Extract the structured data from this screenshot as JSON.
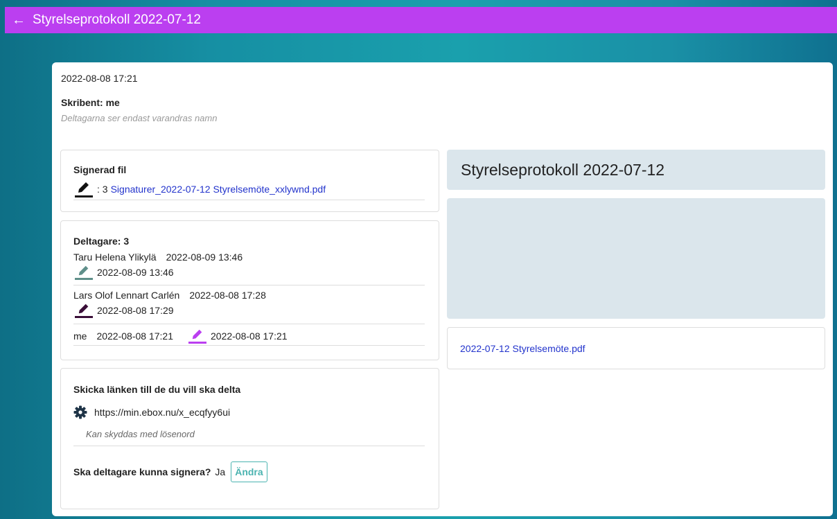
{
  "header": {
    "back_icon": "arrow-left-icon",
    "title": "Styrelseprotokoll 2022-07-12",
    "bg_color": "#bb3ff0"
  },
  "meta": {
    "date": "2022-08-08 17:21",
    "scribe": "Skribent: me",
    "scribe_note": "Deltagarna ser endast varandras namn"
  },
  "signed_file": {
    "title": "Signerad fil",
    "icon": "pen-icon",
    "count": ": 3",
    "file_link": "Signaturer_2022-07-12 Styrelsemöte_xxlywnd.pdf"
  },
  "participants": {
    "title": "Deltagare: 3",
    "rows": [
      {
        "name": "Taru Helena Ylikylä",
        "joined": "2022-08-09 13:46",
        "signed": "2022-08-09 13:46",
        "pen_color": "#5f8f8a"
      },
      {
        "name": "Lars Olof Lennart Carlén",
        "joined": "2022-08-08 17:28",
        "signed": "2022-08-08 17:29",
        "pen_color": "#3a0e38"
      },
      {
        "name": "me",
        "joined": "2022-08-08 17:21",
        "signed": "2022-08-08 17:21",
        "pen_color": "#bb3ff0"
      }
    ]
  },
  "share": {
    "title": "Skicka länken till de du vill ska delta",
    "icon": "gear-icon",
    "url": "https://min.ebox.nu/x_ecqfyy6ui",
    "note": "Kan skyddas med lösenord",
    "sign_question": "Ska deltagare kunna signera?",
    "sign_answer": "Ja",
    "change_button": "Ändra"
  },
  "document": {
    "title": "Styrelseprotokoll 2022-07-12",
    "file_link": "2022-07-12 Styrelsemöte.pdf"
  }
}
